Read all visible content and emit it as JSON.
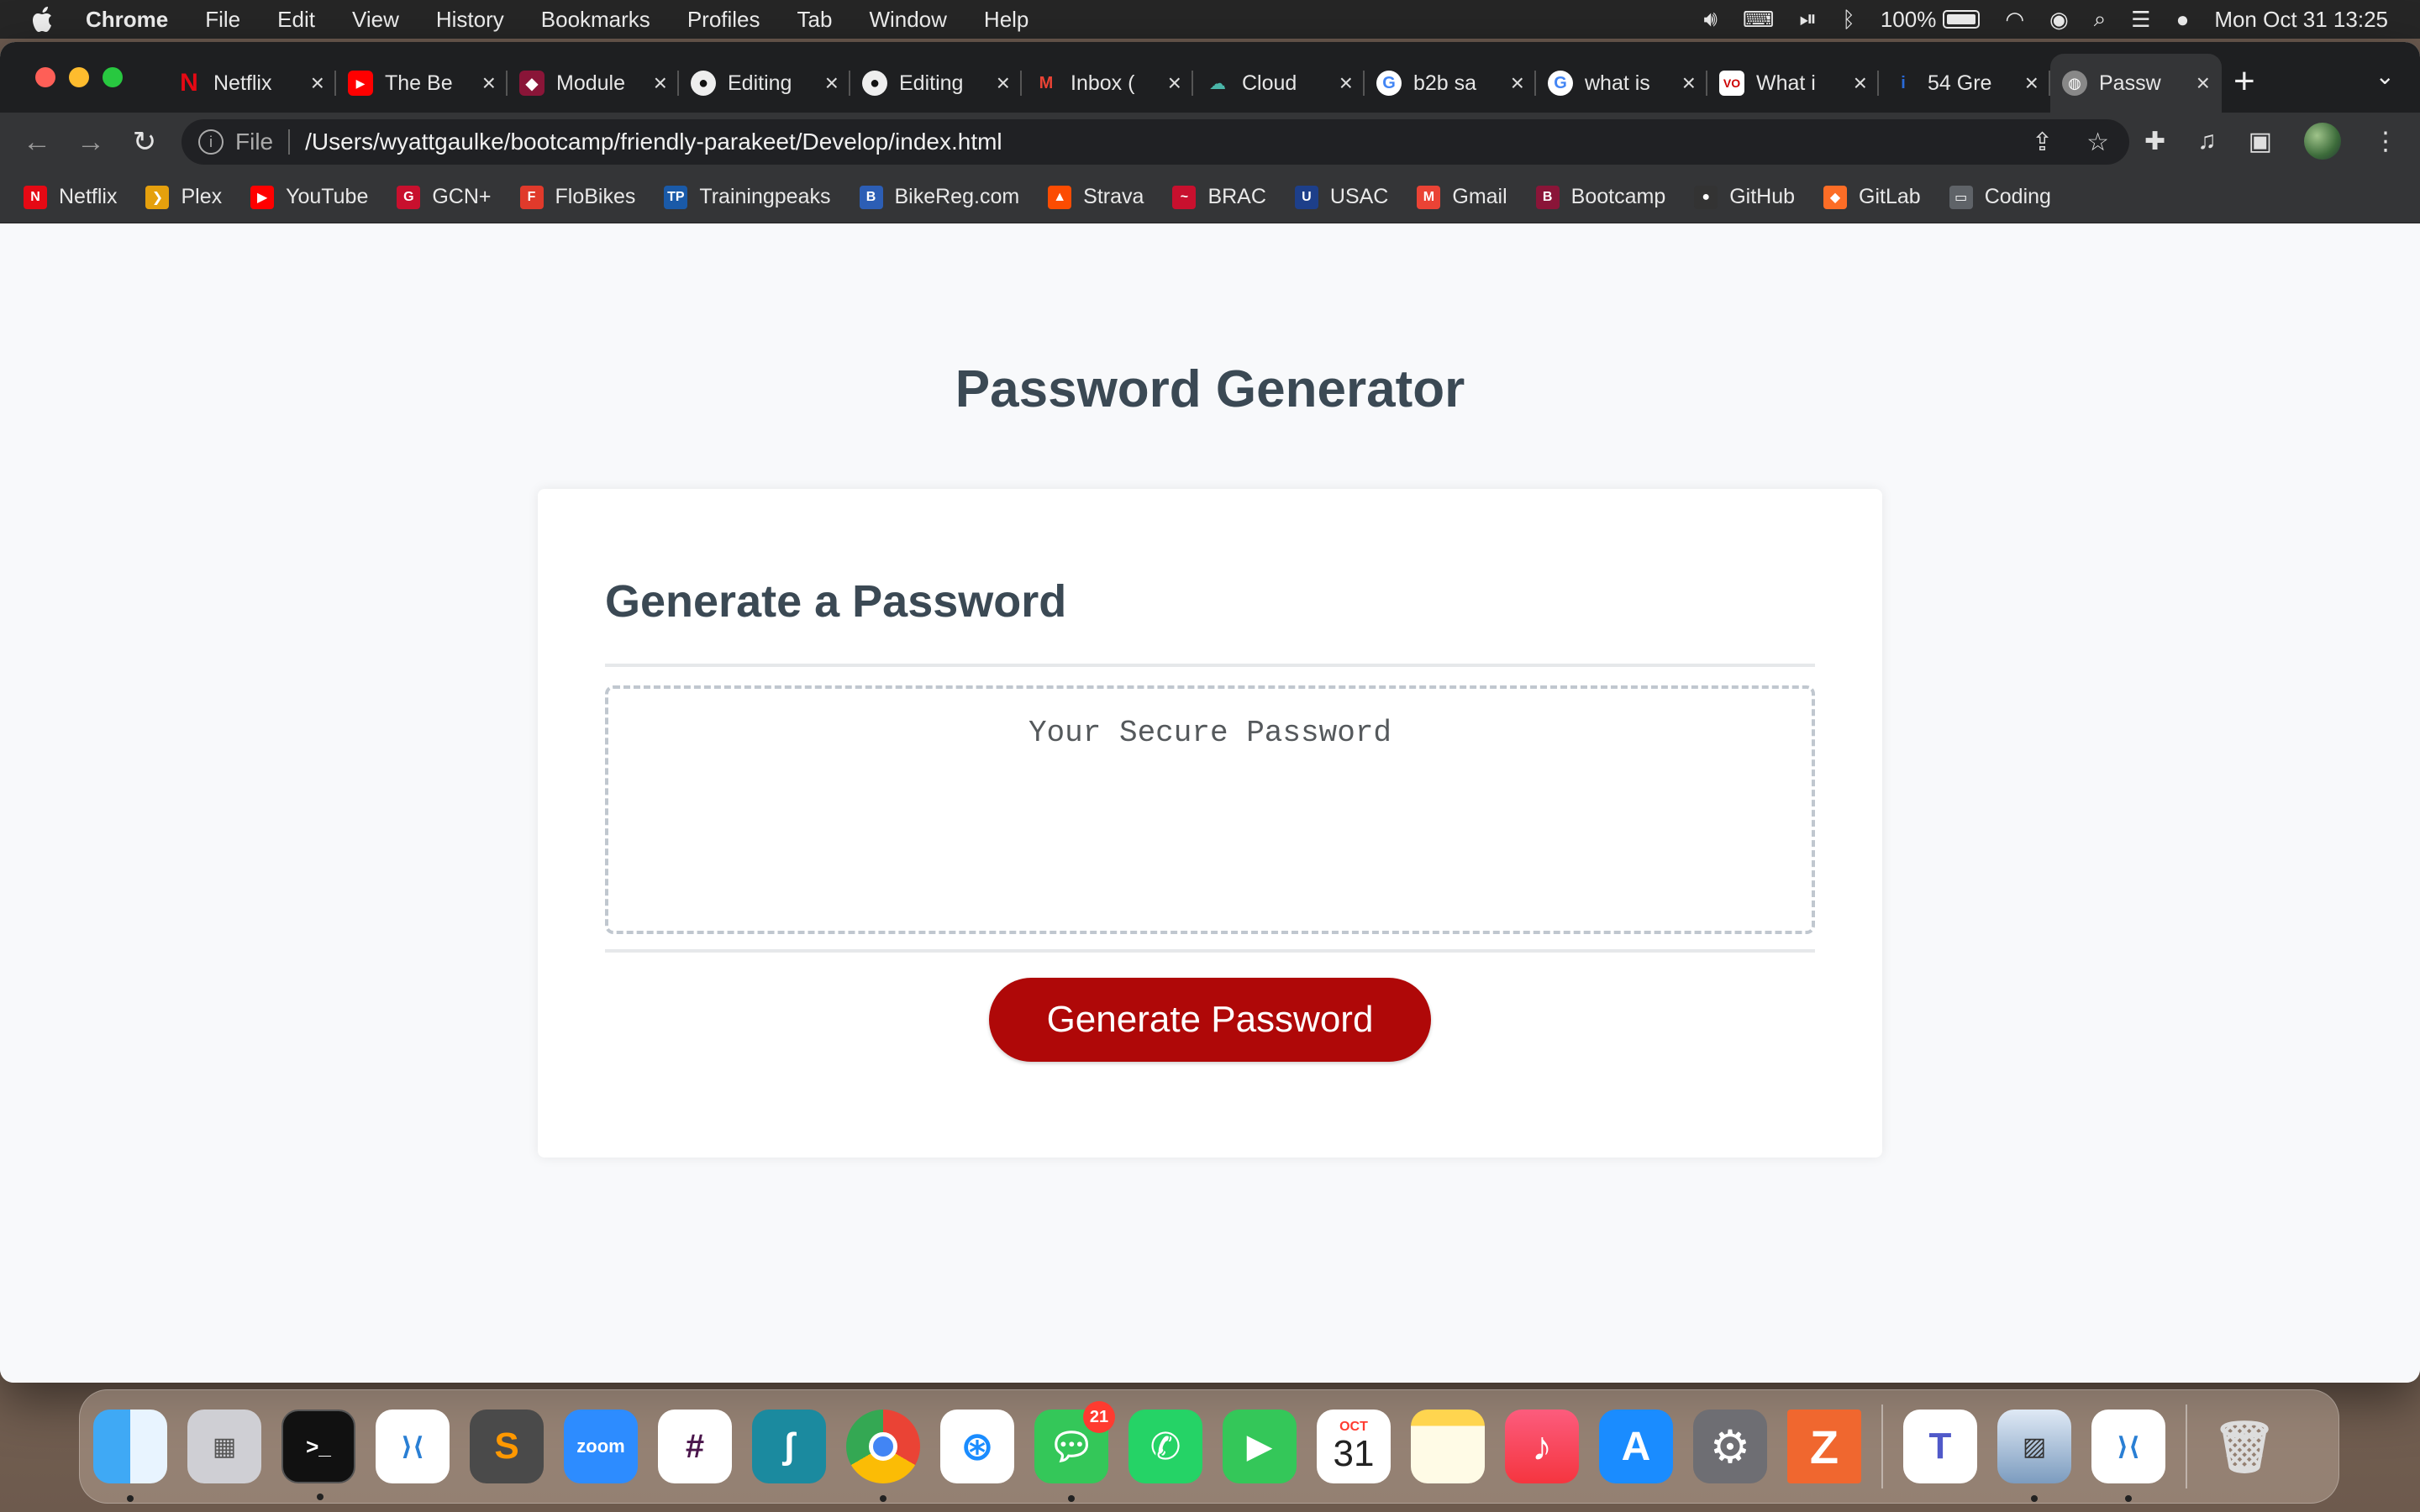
{
  "menubar": {
    "app_name": "Chrome",
    "items": [
      "File",
      "Edit",
      "View",
      "History",
      "Bookmarks",
      "Profiles",
      "Tab",
      "Window",
      "Help"
    ],
    "battery": "100%",
    "clock": "Mon Oct 31  13:25"
  },
  "browser": {
    "tabs": [
      {
        "label": "Netflix",
        "icon": "netflix-icon"
      },
      {
        "label": "The Be",
        "icon": "youtube-icon"
      },
      {
        "label": "Module",
        "icon": "bootcamp-icon"
      },
      {
        "label": "Editing",
        "icon": "github-icon"
      },
      {
        "label": "Editing",
        "icon": "github-icon"
      },
      {
        "label": "Inbox (",
        "icon": "gmail-icon"
      },
      {
        "label": "Cloud",
        "icon": "cloud-icon"
      },
      {
        "label": "b2b sa",
        "icon": "google-icon"
      },
      {
        "label": "what is",
        "icon": "google-icon"
      },
      {
        "label": "What i",
        "icon": "vo-icon"
      },
      {
        "label": "54 Gre",
        "icon": "info-icon"
      },
      {
        "label": "Passw",
        "icon": "globe-icon"
      }
    ],
    "omnibox": {
      "scheme": "File",
      "url": "/Users/wyattgaulke/bootcamp/friendly-parakeet/Develop/index.html"
    },
    "bookmarks": [
      {
        "label": "Netflix",
        "color": "#e50914",
        "glyph": "N"
      },
      {
        "label": "Plex",
        "color": "#e5a00d",
        "glyph": "❯"
      },
      {
        "label": "YouTube",
        "color": "#ff0000",
        "glyph": "▶"
      },
      {
        "label": "GCN+",
        "color": "#c8102e",
        "glyph": "G"
      },
      {
        "label": "FloBikes",
        "color": "#e03a2b",
        "glyph": "F"
      },
      {
        "label": "Trainingpeaks",
        "color": "#1a5aa8",
        "glyph": "TP"
      },
      {
        "label": "BikeReg.com",
        "color": "#2c5eb5",
        "glyph": "B"
      },
      {
        "label": "Strava",
        "color": "#fc4c02",
        "glyph": "▲"
      },
      {
        "label": "BRAC",
        "color": "#c8102e",
        "glyph": "~"
      },
      {
        "label": "USAC",
        "color": "#1d3f8a",
        "glyph": "U"
      },
      {
        "label": "Gmail",
        "color": "#ea4335",
        "glyph": "M"
      },
      {
        "label": "Bootcamp",
        "color": "#8a1538",
        "glyph": "B"
      },
      {
        "label": "GitHub",
        "color": "#333333",
        "glyph": "●"
      },
      {
        "label": "GitLab",
        "color": "#fc6d26",
        "glyph": "◆"
      },
      {
        "label": "Coding",
        "color": "#5f6368",
        "glyph": "▭"
      }
    ]
  },
  "page": {
    "title": "Password Generator",
    "card_header": "Generate a Password",
    "password_placeholder": "Your Secure Password",
    "password_value": "",
    "generate_button": "Generate Password",
    "accent_color": "#b01a1a"
  },
  "dock": {
    "apps": [
      "Finder",
      "Launchpad",
      "Terminal",
      "Visual Studio Code",
      "Sublime Text",
      "Zoom",
      "Slack",
      "Surfshark",
      "Google Chrome",
      "Safari",
      "Messages",
      "WhatsApp",
      "FaceTime",
      "Calendar",
      "Notes",
      "Music",
      "App Store",
      "System Preferences",
      "Zotero",
      "Microsoft Teams",
      "Preview",
      "Visual Studio Code"
    ],
    "messages_badge": "21",
    "calendar_month": "OCT",
    "calendar_day": "31"
  }
}
